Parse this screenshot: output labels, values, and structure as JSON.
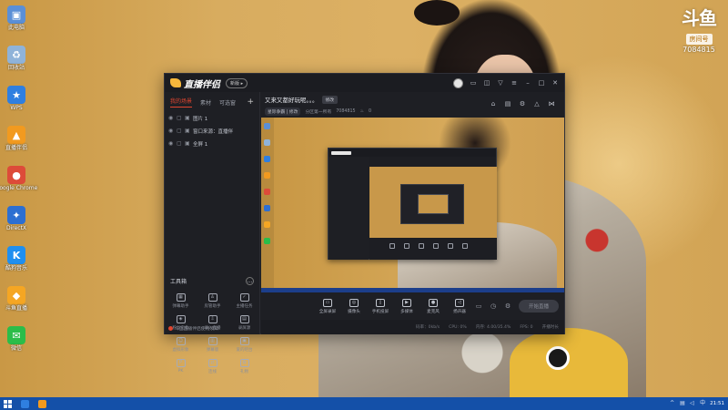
{
  "watermark": {
    "logo": "斗鱼",
    "tag": "房间号",
    "room_id": "7084815"
  },
  "desktop_icons": [
    {
      "label": "此电脑",
      "icon": "computer-icon",
      "color": "#5a8fd6"
    },
    {
      "label": "回收站",
      "icon": "recycle-bin-icon",
      "color": "#8fb3d9"
    },
    {
      "label": "WPS",
      "icon": "star-app-icon",
      "color": "#2f7fe0"
    },
    {
      "label": "直播伴侣",
      "icon": "douyu-companion-icon",
      "color": "#f29a1f"
    },
    {
      "label": "Google Chrome",
      "icon": "chrome-icon",
      "color": "#dd4b39"
    },
    {
      "label": "DirectX",
      "icon": "app-blue-icon",
      "color": "#2d6fd1"
    },
    {
      "label": "酷狗音乐",
      "icon": "kugou-icon",
      "color": "#1f8ff0"
    },
    {
      "label": "斗鱼直播",
      "icon": "douyu-icon",
      "color": "#f5a623"
    },
    {
      "label": "微信",
      "icon": "wechat-icon",
      "color": "#2bbd49"
    }
  ],
  "app": {
    "brand": "直播伴侣",
    "version_badge": "新版 ▸",
    "source_tabs": [
      "我的场景",
      "素材",
      "可选窗"
    ],
    "add_symbol": "+",
    "sources": [
      {
        "label": "图片 1"
      },
      {
        "label": "窗口来源：直播伴"
      },
      {
        "label": "全屏 1"
      }
    ],
    "tools_title": "工具箱",
    "tools_more": "…",
    "tools": [
      "弹幕助手",
      "房管助手",
      "主播任务",
      "粉丝宝盒",
      "录入直播",
      "录屏源",
      "虚拟形象",
      "弹幕版",
      "爱的吧台",
      "PK",
      "连线",
      "礼物"
    ],
    "footer_text": "斗鱼直播伴侣使用须知",
    "room_title": "又来又都好玩呢。。。",
    "modify_label": "修改",
    "room_meta": {
      "category": "星际争霸 | 修改",
      "line": "分区第一所有",
      "room": "7084815",
      "heat": "0"
    },
    "controls": [
      {
        "label": "全屏录屏",
        "icon": "screen-capture-icon"
      },
      {
        "label": "摄像头",
        "icon": "camera-icon"
      },
      {
        "label": "手机投屏",
        "icon": "phone-cast-icon"
      },
      {
        "label": "多媒体",
        "icon": "media-icon"
      },
      {
        "label": "麦克风",
        "icon": "mic-icon"
      },
      {
        "label": "扬声器",
        "icon": "speaker-icon"
      }
    ],
    "live_button": "开始直播",
    "status": [
      "码率：0kb/s",
      "CPU: 0%",
      "内存: 4.00/35.4%",
      "FPS: 0",
      "开播时长"
    ]
  },
  "taskbar": {
    "time": "21:51"
  }
}
